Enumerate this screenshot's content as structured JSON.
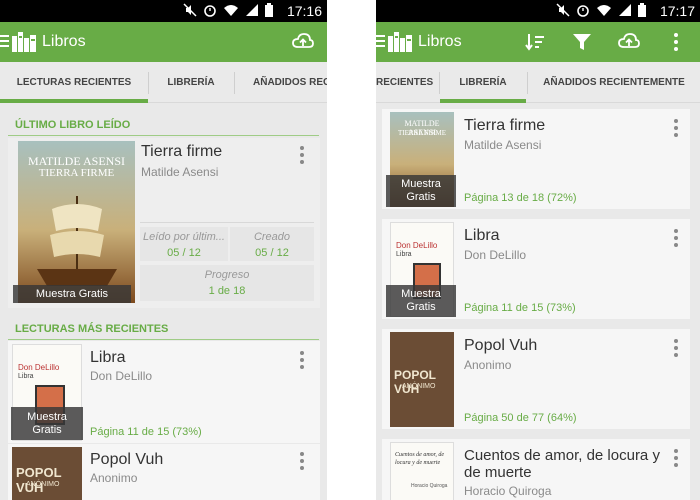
{
  "status": {
    "time": "17:16",
    "time_right": "17:17"
  },
  "app": {
    "title": "Libros"
  },
  "tabs_left": [
    "LECTURAS RECIENTES",
    "LIBRERÍA",
    "AÑADIDOS RECI"
  ],
  "tabs_right": [
    "RECIENTES",
    "LIBRERÍA",
    "AÑADIDOS RECIENTEMENTE"
  ],
  "left": {
    "last_read_title": "ÚLTIMO LIBRO LEÍDO",
    "last_book": {
      "title": "Tierra firme",
      "author": "Matilde Asensi",
      "cover_author": "MATILDE ASENSI",
      "cover_title": "TIERRA FIRME",
      "sample": "Muestra Gratis",
      "last_read_label": "Leído por últim...",
      "last_read_value": "05 / 12",
      "created_label": "Creado",
      "created_value": "05 / 12",
      "progress_label": "Progreso",
      "progress_value": "1 de 18"
    },
    "recent_title": "LECTURAS MÁS RECIENTES",
    "recent": [
      {
        "title": "Libra",
        "author": "Don DeLillo",
        "progress": "Página 11 de 15 (73%)",
        "sample": "Muestra Gratis",
        "cover_author": "Don DeLillo",
        "cover_title": "Libra"
      },
      {
        "title": "Popol Vuh",
        "author": "Anonimo",
        "cover_title": "POPOL VUH",
        "cover_sub": "ANÓNIMO"
      }
    ]
  },
  "right": {
    "books": [
      {
        "title": "Tierra firme",
        "author": "Matilde Asensi",
        "progress": "Página 13 de 18 (72%)",
        "sample": "Muestra Gratis",
        "cover_author": "MATILDE ASENSI",
        "cover_title": "TIERRA FIRME"
      },
      {
        "title": "Libra",
        "author": "Don DeLillo",
        "progress": "Página 11 de 15 (73%)",
        "sample": "Muestra Gratis",
        "cover_author": "Don DeLillo",
        "cover_title": "Libra"
      },
      {
        "title": "Popol Vuh",
        "author": "Anonimo",
        "progress": "Página 50 de 77 (64%)",
        "cover_title": "POPOL VUH",
        "cover_sub": "ANÓNIMO"
      },
      {
        "title": "Cuentos de amor, de locura y de muerte",
        "author": "Horacio Quiroga",
        "cover_title": "Cuentos de amor, de locura y de muerte",
        "cover_author": "Horacio Quiroga"
      }
    ]
  },
  "colors": {
    "accent": "#68ac46",
    "appbar": "#68ac46"
  }
}
